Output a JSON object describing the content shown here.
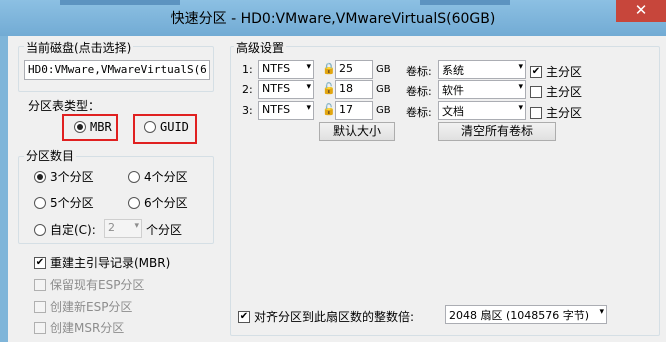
{
  "window": {
    "title": "快速分区 - HD0:VMware,VMwareVirtualS(60GB)",
    "close_symbol": "✕"
  },
  "current_disk": {
    "label": "当前磁盘(点击选择)",
    "value": "HD0:VMware,VMwareVirtualS(6"
  },
  "partition_type": {
    "label": "分区表类型：",
    "mbr": "MBR",
    "guid": "GUID"
  },
  "partition_count": {
    "label": "分区数目",
    "opt3": "3个分区",
    "opt4": "4个分区",
    "opt5": "5个分区",
    "opt6": "6个分区",
    "custom": "自定(C):",
    "custom_value": "2",
    "custom_suffix": "个分区"
  },
  "options": {
    "rebuild_mbr": "重建主引导记录(MBR)",
    "keep_esp": "保留现有ESP分区",
    "create_esp": "创建新ESP分区",
    "create_msr": "创建MSR分区"
  },
  "advanced": {
    "label": "高级设置",
    "vol_label": "卷标:",
    "primary": "主分区",
    "rows": [
      {
        "index": "1:",
        "fs": "NTFS",
        "size": "25",
        "unit": "GB",
        "volume": "系统",
        "primary_checked": true
      },
      {
        "index": "2:",
        "fs": "NTFS",
        "size": "18",
        "unit": "GB",
        "volume": "软件",
        "primary_checked": false
      },
      {
        "index": "3:",
        "fs": "NTFS",
        "size": "17",
        "unit": "GB",
        "volume": "文档",
        "primary_checked": false
      }
    ],
    "default_size_btn": "默认大小",
    "clear_labels_btn": "清空所有卷标",
    "align_label": "对齐分区到此扇区数的整数倍:",
    "align_value": "2048 扇区 (1048576 字节)"
  }
}
